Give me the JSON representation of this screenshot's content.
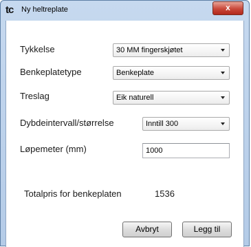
{
  "window": {
    "title": "Ny heltreplate",
    "app_icon": "tc",
    "close_label": "x"
  },
  "form": {
    "thickness_label": "Tykkelse",
    "thickness_value": "30 MM fingerskjøtet",
    "type_label": "Benkeplatetype",
    "type_value": "Benkeplate",
    "wood_label": "Treslag",
    "wood_value": "Eik naturell",
    "depth_label": "Dybdeintervall/størrelse",
    "depth_value": "Inntill 300",
    "length_label": "Løpemeter (mm)",
    "length_value": "1000"
  },
  "total": {
    "label": "Totalpris for benkeplaten",
    "value": "1536"
  },
  "buttons": {
    "cancel": "Avbryt",
    "add": "Legg til"
  }
}
